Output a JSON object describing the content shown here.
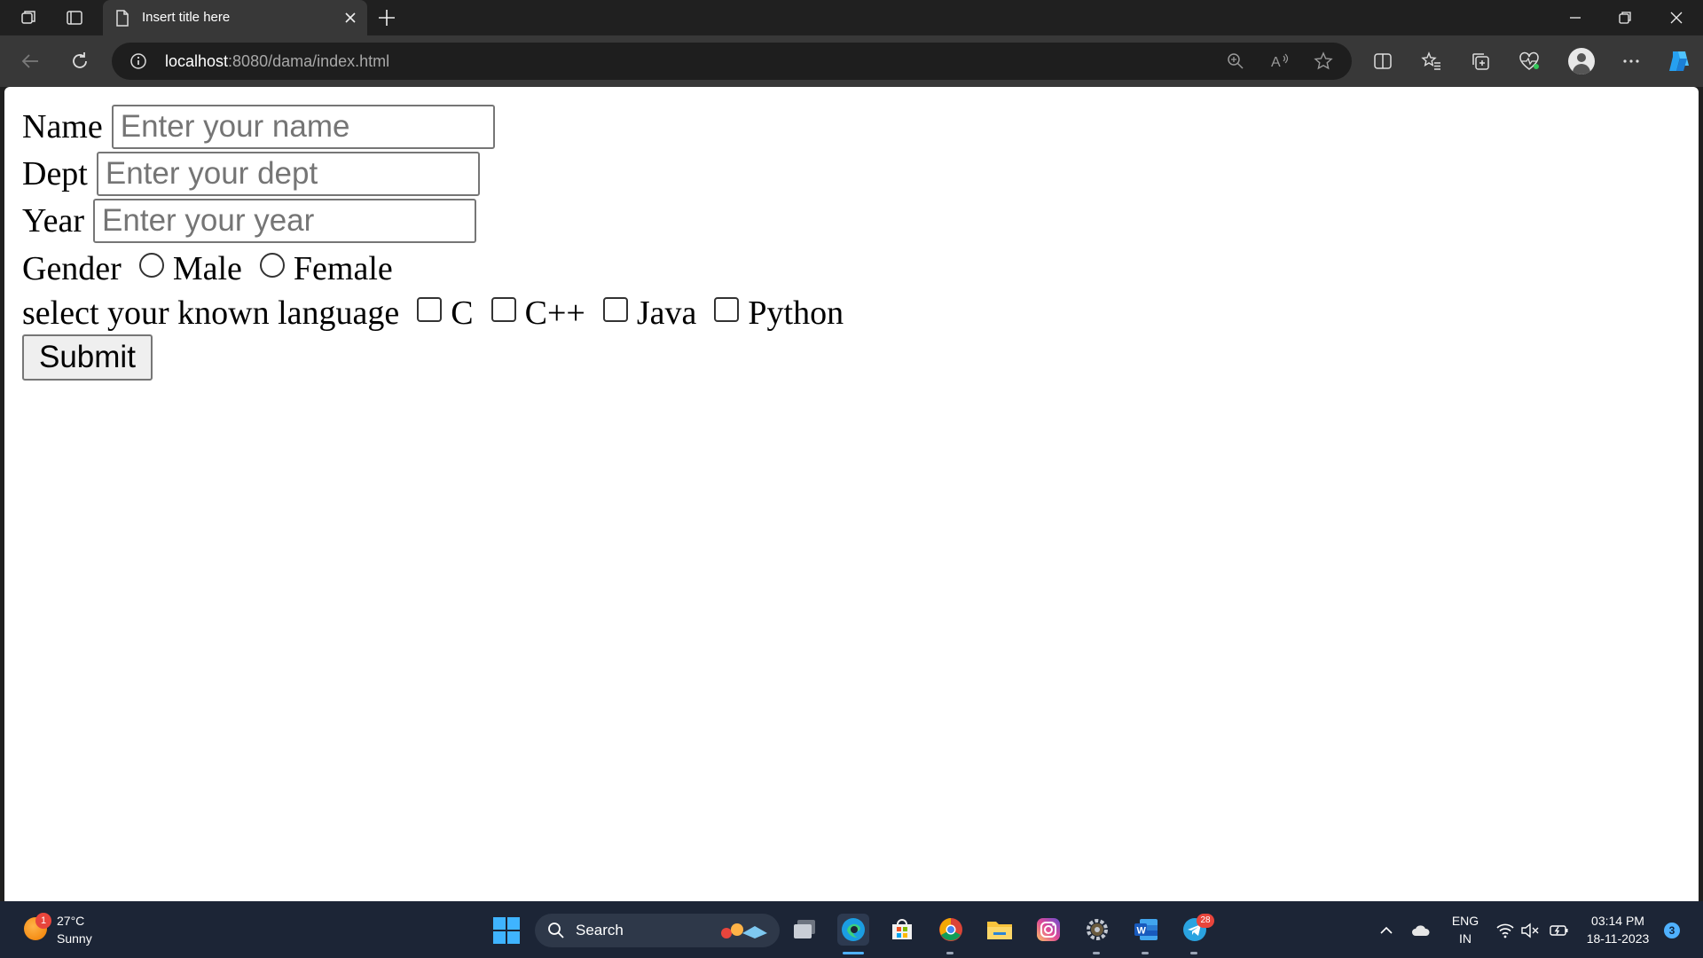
{
  "browser": {
    "tab_title": "Insert title here",
    "url_host": "localhost",
    "url_rest": ":8080/dama/index.html"
  },
  "form": {
    "name_label": "Name",
    "name_placeholder": "Enter your name",
    "dept_label": "Dept",
    "dept_placeholder": "Enter your dept",
    "year_label": "Year",
    "year_placeholder": "Enter your year",
    "gender_label": "Gender",
    "gender_options": [
      "Male",
      "Female"
    ],
    "language_label": "select your known language",
    "language_options": [
      "C",
      "C++",
      "Java",
      "Python"
    ],
    "submit_label": "Submit"
  },
  "taskbar": {
    "weather_badge": "1",
    "weather_temp": "27°C",
    "weather_condition": "Sunny",
    "search_label": "Search",
    "telegram_badge": "28",
    "lang_top": "ENG",
    "lang_bottom": "IN",
    "time": "03:14 PM",
    "date": "18-11-2023",
    "notification_count": "3"
  },
  "colors": {
    "accent": "#3fb4ff",
    "badge_red": "#e8453c"
  }
}
